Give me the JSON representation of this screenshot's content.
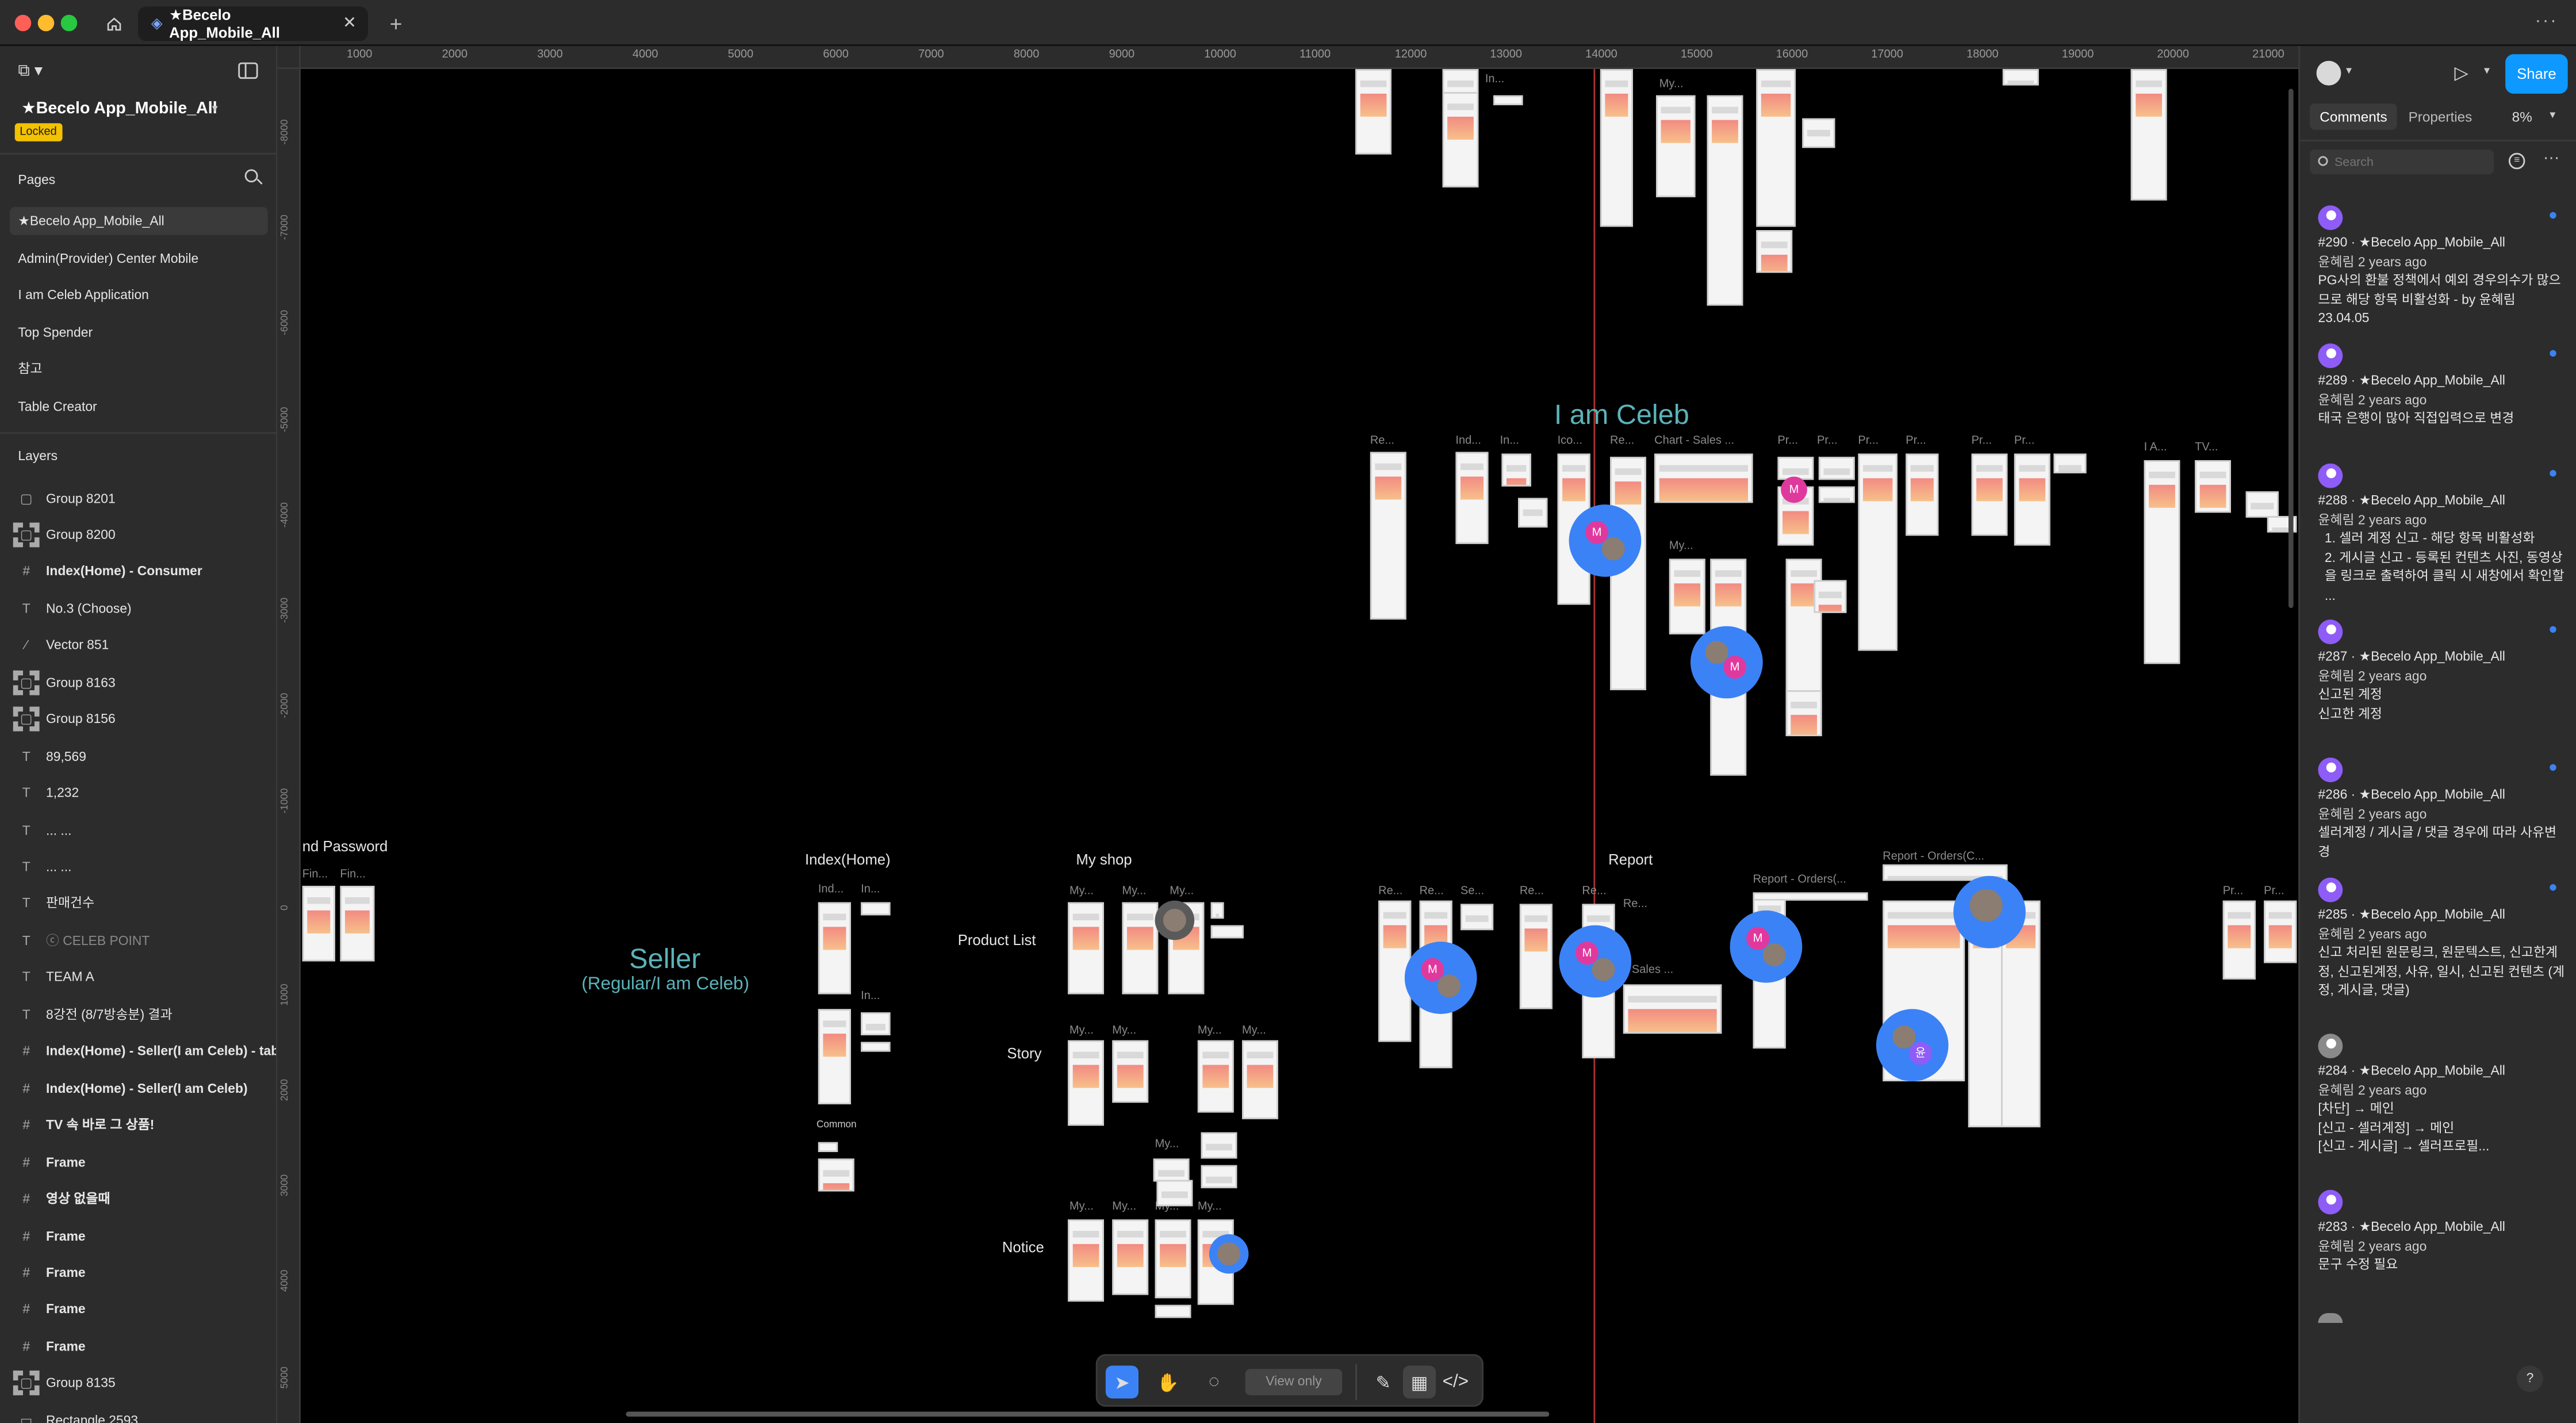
{
  "titlebar": {
    "tab_title": "★Becelo App_Mobile_All"
  },
  "file": {
    "name": "★Becelo App_Mobile_All",
    "locked_badge": "Locked"
  },
  "pages": {
    "heading": "Pages",
    "items": [
      "★Becelo App_Mobile_All",
      "Admin(Provider) Center Mobile",
      "I am Celeb Application",
      "Top Spender",
      "참고",
      "Table Creator"
    ]
  },
  "layers": {
    "heading": "Layers",
    "items": [
      {
        "icon": "group-icon",
        "label": "Group 8201"
      },
      {
        "icon": "group-icon",
        "label": "Group 8200"
      },
      {
        "icon": "frame-icon",
        "label": "Index(Home) - Consumer"
      },
      {
        "icon": "text-icon",
        "label": "No.3 (Choose)"
      },
      {
        "icon": "vector-icon",
        "label": "Vector 851"
      },
      {
        "icon": "group-icon",
        "label": "Group 8163"
      },
      {
        "icon": "group-icon",
        "label": "Group 8156"
      },
      {
        "icon": "text-icon",
        "label": "89,569"
      },
      {
        "icon": "text-icon",
        "label": "1,232"
      },
      {
        "icon": "text-icon",
        "label": "... ..."
      },
      {
        "icon": "text-icon",
        "label": "... ..."
      },
      {
        "icon": "text-icon",
        "label": "판매건수"
      },
      {
        "icon": "text-icon",
        "label": "ⓒ CELEB POINT"
      },
      {
        "icon": "text-icon",
        "label": "TEAM A"
      },
      {
        "icon": "text-icon",
        "label": "8강전 (8/7방송분) 결과"
      },
      {
        "icon": "frame-icon",
        "label": "Index(Home) - Seller(I am Celeb) - tab"
      },
      {
        "icon": "frame-icon",
        "label": "Index(Home) - Seller(I am Celeb)"
      },
      {
        "icon": "frame-icon",
        "label": "TV 속 바로 그 상품!"
      },
      {
        "icon": "frame-icon",
        "label": "Frame"
      },
      {
        "icon": "frame-icon",
        "label": "영상 없을때"
      },
      {
        "icon": "frame-icon",
        "label": "Frame"
      },
      {
        "icon": "frame-icon",
        "label": "Frame"
      },
      {
        "icon": "frame-icon",
        "label": "Frame"
      },
      {
        "icon": "frame-icon",
        "label": "Frame"
      },
      {
        "icon": "group-icon",
        "label": "Group 8135"
      },
      {
        "icon": "rect-icon",
        "label": "Rectangle 2593"
      }
    ]
  },
  "ruler": {
    "top": [
      "1000",
      "2000",
      "3000",
      "4000",
      "5000",
      "6000",
      "7000",
      "8000",
      "9000",
      "10000",
      "11000",
      "12000",
      "13000",
      "14000",
      "15000",
      "16000",
      "17000",
      "18000",
      "19000",
      "20000",
      "21000"
    ],
    "left": [
      "-8000",
      "-7000",
      "-6000",
      "-5000",
      "-4000",
      "-3000",
      "-2000",
      "-1000",
      "0",
      "1000",
      "2000",
      "3000",
      "4000",
      "5000"
    ]
  },
  "canvas": {
    "section_labels": {
      "find_password": "nd Password",
      "index_home": "Index(Home)",
      "my_shop": "My shop",
      "report": "Report",
      "product_list": "Product  List",
      "story": "Story",
      "notice": "Notice",
      "common": "Common"
    },
    "seller_title": "Seller",
    "seller_subtitle": "(Regular/I am Celeb)",
    "celeb_title": "I am Celeb",
    "frame_labels": {
      "l1": "Fin...",
      "l2": "Fin...",
      "l3": "Ind...",
      "l4": "In...",
      "l5": "In...",
      "l6": "My...",
      "l7": "My...",
      "l8": "My...",
      "l9": "My...",
      "l10": "My...",
      "l11": "My...",
      "l12": "My...",
      "l13": "My...",
      "l14": "My...",
      "l15": "My...",
      "l16": "My...",
      "l17": "My...",
      "r1": "Re...",
      "r2": "Re...",
      "r3": "Se...",
      "r4": "Re...",
      "r5": "Re...",
      "r6": "Re...",
      "r7": "Report - Orders(...",
      "r8": "Report - Orders(C...",
      "r9": "Pr...",
      "r10": "Pr...",
      "r11": "- Sales ...",
      "c1": "Re...",
      "c2": "Ind...",
      "c3": "In...",
      "c4": "Ico...",
      "c5": "Re...",
      "c6": "Chart - Sales ...",
      "c7": "Pr...",
      "c8": "Pr...",
      "c9": "Pr...",
      "c10": "Pr...",
      "c11": "Pr...",
      "c12": "Pr...",
      "c13": "I A...",
      "c14": "TV...",
      "c15": "My...",
      "c16": "My...",
      "c17": "In..."
    },
    "avatar_m": "M",
    "avatar_yoon": "윤"
  },
  "toolbar": {
    "view_only": "View only"
  },
  "rightpanel": {
    "share_label": "Share",
    "tab_comments": "Comments",
    "tab_properties": "Properties",
    "zoom": "8%",
    "search_placeholder": "Search",
    "comments": [
      {
        "title": "#290 · ★Becelo App_Mobile_All",
        "author": "윤혜림 2 years ago",
        "body": "PG사의 환불 정책에서 예외 경우의수가 많으므로 해당 항목 비활성화 -  by 윤혜림 23.04.05"
      },
      {
        "title": "#289 · ★Becelo App_Mobile_All",
        "author": "윤혜림 2 years ago",
        "body": "태국 은행이 많아 직접입력으로 변경"
      },
      {
        "title": "#288 · ★Becelo App_Mobile_All",
        "author": "윤혜림 2 years ago",
        "body": "1. 셀러 계정 신고 - 해당 항목 비활성화\n2. 게시글 신고 - 등록된 컨텐츠 사진, 동영상을 링크로 출력하여 클릭 시 새창에서 확인할 ..."
      },
      {
        "title": "#287 · ★Becelo App_Mobile_All",
        "author": "윤혜림 2 years ago",
        "body": "신고된 계정\n신고한 계정"
      },
      {
        "title": "#286 · ★Becelo App_Mobile_All",
        "author": "윤혜림 2 years ago",
        "body": "셀러계정 / 게시글 / 댓글 경우에 따라 사유변경"
      },
      {
        "title": "#285 · ★Becelo App_Mobile_All",
        "author": "윤혜림 2 years ago",
        "body": "신고 처리된 원문링크, 원문텍스트, 신고한계정, 신고된계정, 사유, 일시, 신고된 컨텐츠 (계정, 게시글, 댓글)"
      },
      {
        "title": "#284 · ★Becelo App_Mobile_All",
        "author": "윤혜림 2 years ago",
        "body": "[차단] → 메인\n[신고 - 셀러계정] → 메인\n[신고 - 게시글] → 셀러프로필..."
      },
      {
        "title": "#283 · ★Becelo App_Mobile_All",
        "author": "윤혜림 2 years ago",
        "body": "문구 수정 필요"
      }
    ],
    "help": "?"
  }
}
